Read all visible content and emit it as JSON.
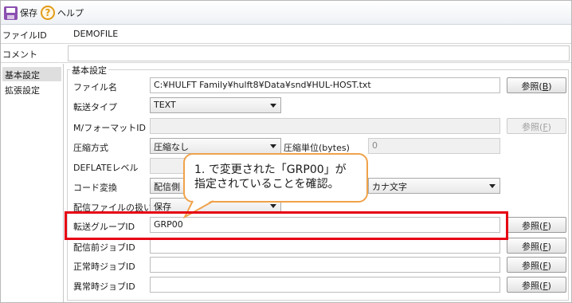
{
  "toolbar": {
    "save_label": "保存",
    "help_label": "ヘルプ",
    "help_glyph": "?"
  },
  "header": {
    "file_id_label": "ファイルID",
    "file_id_value": "DEMOFILE",
    "comment_label": "コメント",
    "comment_value": ""
  },
  "nav": {
    "items": [
      {
        "label": "基本設定"
      },
      {
        "label": "拡張設定"
      }
    ]
  },
  "group": {
    "title": "基本設定",
    "filename_label": "ファイル名",
    "filename_value": "C:¥HULFT Family¥hulft8¥Data¥snd¥HUL-HOST.txt",
    "browse_label": "参照(",
    "browse_key_b": "B",
    "browse_key_f": "F",
    "browse_close": ")",
    "transfer_type_label": "転送タイプ",
    "transfer_type_value": "TEXT",
    "format_id_label": "M/フォーマットID",
    "format_id_value": "",
    "compress_label": "圧縮方式",
    "compress_value": "圧縮なし",
    "compress_unit_label": "圧縮単位(bytes)",
    "compress_unit_value": "0",
    "deflate_label": "DEFLATEレベル",
    "code_label": "コード変換",
    "code_value": "配信側",
    "kana_value": "カナ文字",
    "handling_label": "配信ファイルの扱い",
    "handling_value": "保存",
    "group_id_label": "転送グループID",
    "group_id_value": "GRP00",
    "pre_job_label": "配信前ジョブID",
    "ok_job_label": "正常時ジョブID",
    "err_job_label": "異常時ジョブID"
  },
  "callout": {
    "line1": "1. で変更された「GRP00」が",
    "line2": "指定されていることを確認。"
  },
  "colors": {
    "highlight": "#e60012",
    "callout_border": "#f0a24a",
    "accent": "#8b4fb0"
  }
}
